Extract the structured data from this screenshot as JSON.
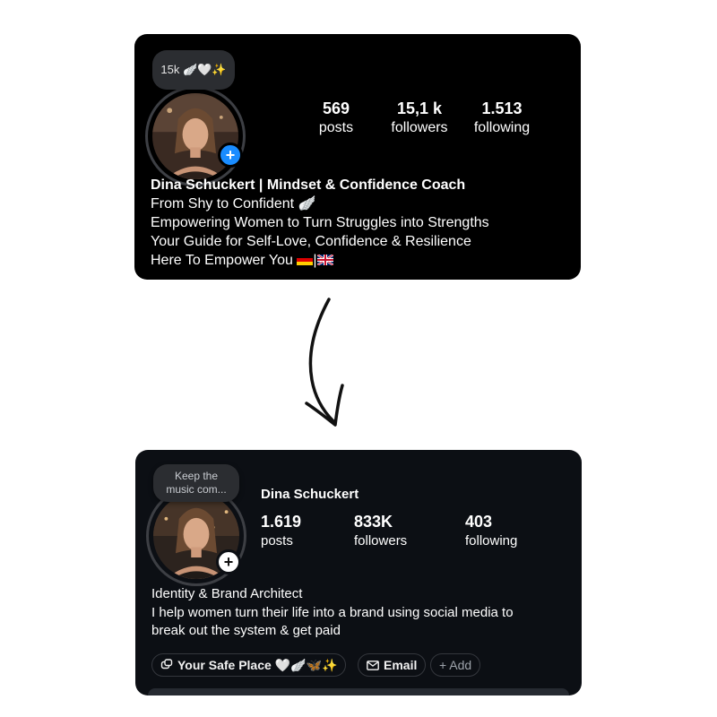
{
  "before": {
    "note": "15k 🪽🤍✨",
    "stats": [
      {
        "value": "569",
        "label": "posts"
      },
      {
        "value": "15,1 k",
        "label": "followers"
      },
      {
        "value": "1.513",
        "label": "following"
      }
    ],
    "name_line": "Dina Schuckert | Mindset & Confidence Coach",
    "bio": [
      "From Shy to Confident 🪽",
      "Empowering Women to Turn Struggles into Strengths",
      "Your Guide for Self-Love, Confidence & Resilience",
      "Here To Empower You"
    ],
    "accent_color": "#1a8cff"
  },
  "after": {
    "note_line1": "Keep the",
    "note_line2": "music com...",
    "display_name": "Dina Schuckert",
    "stats": [
      {
        "value": "1.619",
        "label": "posts"
      },
      {
        "value": "833K",
        "label": "followers"
      },
      {
        "value": "403",
        "label": "following"
      }
    ],
    "bio": [
      "Identity & Brand Architect",
      "I help women turn their life into a brand using social media to",
      "break out the system & get paid"
    ],
    "links": {
      "community": "Your Safe Place 🤍🪽🦋✨",
      "email": "Email",
      "add": "+ Add"
    }
  }
}
